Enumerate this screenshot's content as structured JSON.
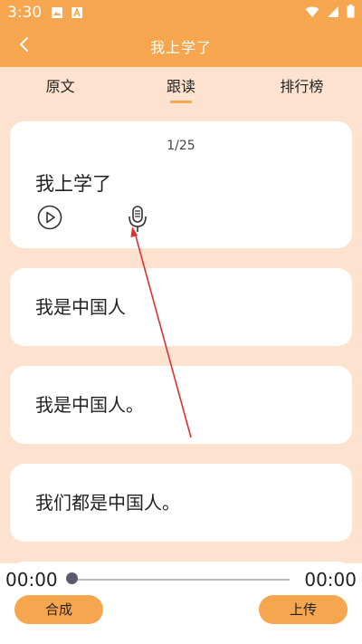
{
  "status_bar": {
    "time": "3:30",
    "icons": [
      "image-icon",
      "a-icon",
      "wifi-icon",
      "signal-icon",
      "battery-icon"
    ]
  },
  "app_bar": {
    "title": "我上学了",
    "back_icon": "chevron-left-icon"
  },
  "tabs": [
    {
      "label": "原文",
      "active": false
    },
    {
      "label": "跟读",
      "active": true
    },
    {
      "label": "排行榜",
      "active": false
    }
  ],
  "main_card": {
    "counter": "1/25",
    "text": "我上学了",
    "play_icon": "play-circle-icon",
    "mic_icon": "microphone-icon"
  },
  "sentences": [
    "我是中国人",
    "我是中国人。",
    "我们都是中国人。"
  ],
  "player": {
    "current_time": "00:00",
    "total_time": "00:00",
    "progress": 0
  },
  "buttons": {
    "compose": "合成",
    "upload": "上传"
  },
  "colors": {
    "accent": "#f5a64e",
    "background": "#fde3cf",
    "card": "#ffffff",
    "annotation_arrow": "#e03030"
  }
}
